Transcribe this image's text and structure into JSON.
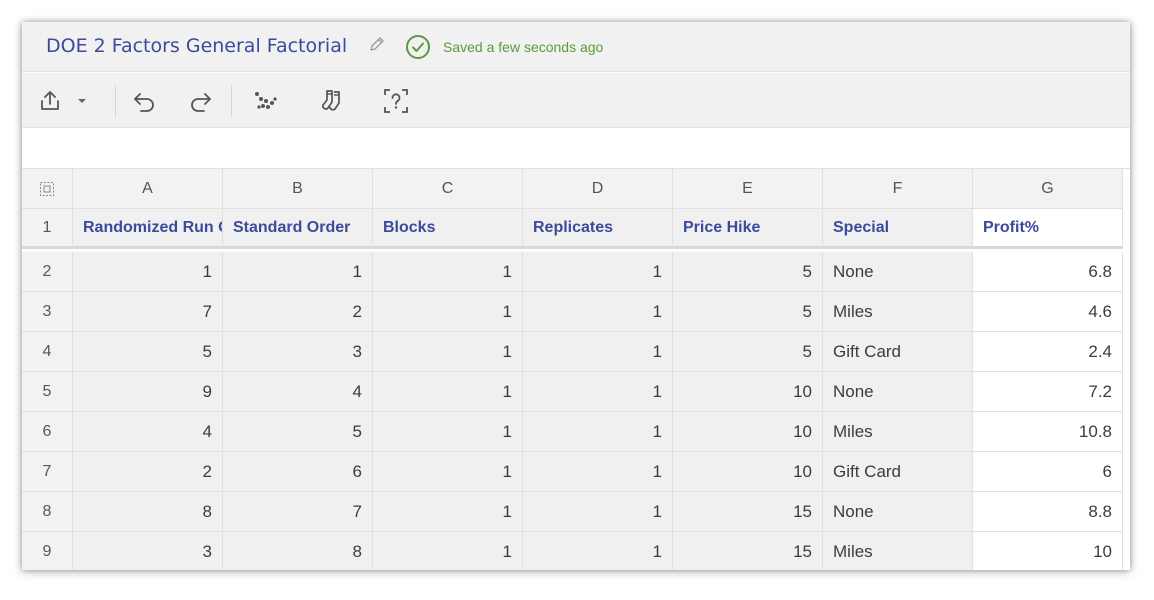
{
  "header": {
    "title": "DOE 2 Factors General Factorial",
    "saved_status": "Saved a few seconds ago"
  },
  "toolbar": {
    "icons": [
      "share-icon",
      "dropdown-caret-icon",
      "undo-icon",
      "redo-icon",
      "scatter-icon",
      "socks-icon",
      "help-icon"
    ]
  },
  "sheet": {
    "column_letters": [
      "A",
      "B",
      "C",
      "D",
      "E",
      "F",
      "G"
    ],
    "column_names": [
      "Randomized Run Order",
      "Standard Order",
      "Blocks",
      "Replicates",
      "Price Hike",
      "Special",
      "Profit%"
    ],
    "row_numbers": [
      "1",
      "2",
      "3",
      "4",
      "5",
      "6",
      "7",
      "8",
      "9"
    ],
    "rows": [
      [
        "1",
        "1",
        "1",
        "1",
        "5",
        "None",
        "6.8"
      ],
      [
        "7",
        "2",
        "1",
        "1",
        "5",
        "Miles",
        "4.6"
      ],
      [
        "5",
        "3",
        "1",
        "1",
        "5",
        "Gift Card",
        "2.4"
      ],
      [
        "9",
        "4",
        "1",
        "1",
        "10",
        "None",
        "7.2"
      ],
      [
        "4",
        "5",
        "1",
        "1",
        "10",
        "Miles",
        "10.8"
      ],
      [
        "2",
        "6",
        "1",
        "1",
        "10",
        "Gift Card",
        "6"
      ],
      [
        "8",
        "7",
        "1",
        "1",
        "15",
        "None",
        "8.8"
      ],
      [
        "3",
        "8",
        "1",
        "1",
        "15",
        "Miles",
        "10"
      ]
    ]
  },
  "colors": {
    "title": "#3b4a9c",
    "saved": "#5a9a3a",
    "column_name": "#3b4a9c"
  }
}
